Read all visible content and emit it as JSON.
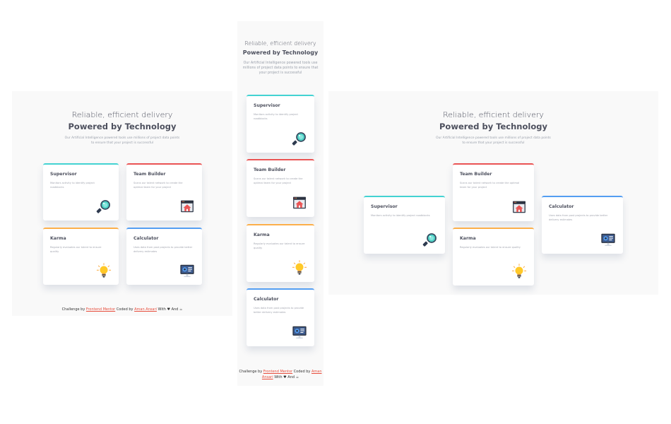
{
  "header": {
    "line1": "Reliable, efficient delivery",
    "line2": "Powered by Technology",
    "description": "Our Artificial Intelligence powered tools use millions of project data points to ensure that your project is successful"
  },
  "cards": {
    "supervisor": {
      "title": "Supervisor",
      "desc": "Monitors activity to identify project roadblocks",
      "icon": "magnifier-icon",
      "accent": "#44d3d2"
    },
    "team_builder": {
      "title": "Team Builder",
      "desc": "Scans our talent network to create the optimal team for your project",
      "icon": "team-builder-icon",
      "accent": "#ea5454"
    },
    "karma": {
      "title": "Karma",
      "desc": "Regularly evaluates our talent to ensure quality",
      "icon": "lightbulb-icon",
      "accent": "#fcaf4a"
    },
    "calculator": {
      "title": "Calculator",
      "desc": "Uses data from past projects to provide better delivery estimates",
      "icon": "calculator-monitor-icon",
      "accent": "#549ef2"
    }
  },
  "footer": {
    "prefix": "Challenge by",
    "fm": "Frontend Mentor",
    "coded": "Coded by",
    "author": "Aman Ansari",
    "with": "With",
    "and": "And"
  }
}
